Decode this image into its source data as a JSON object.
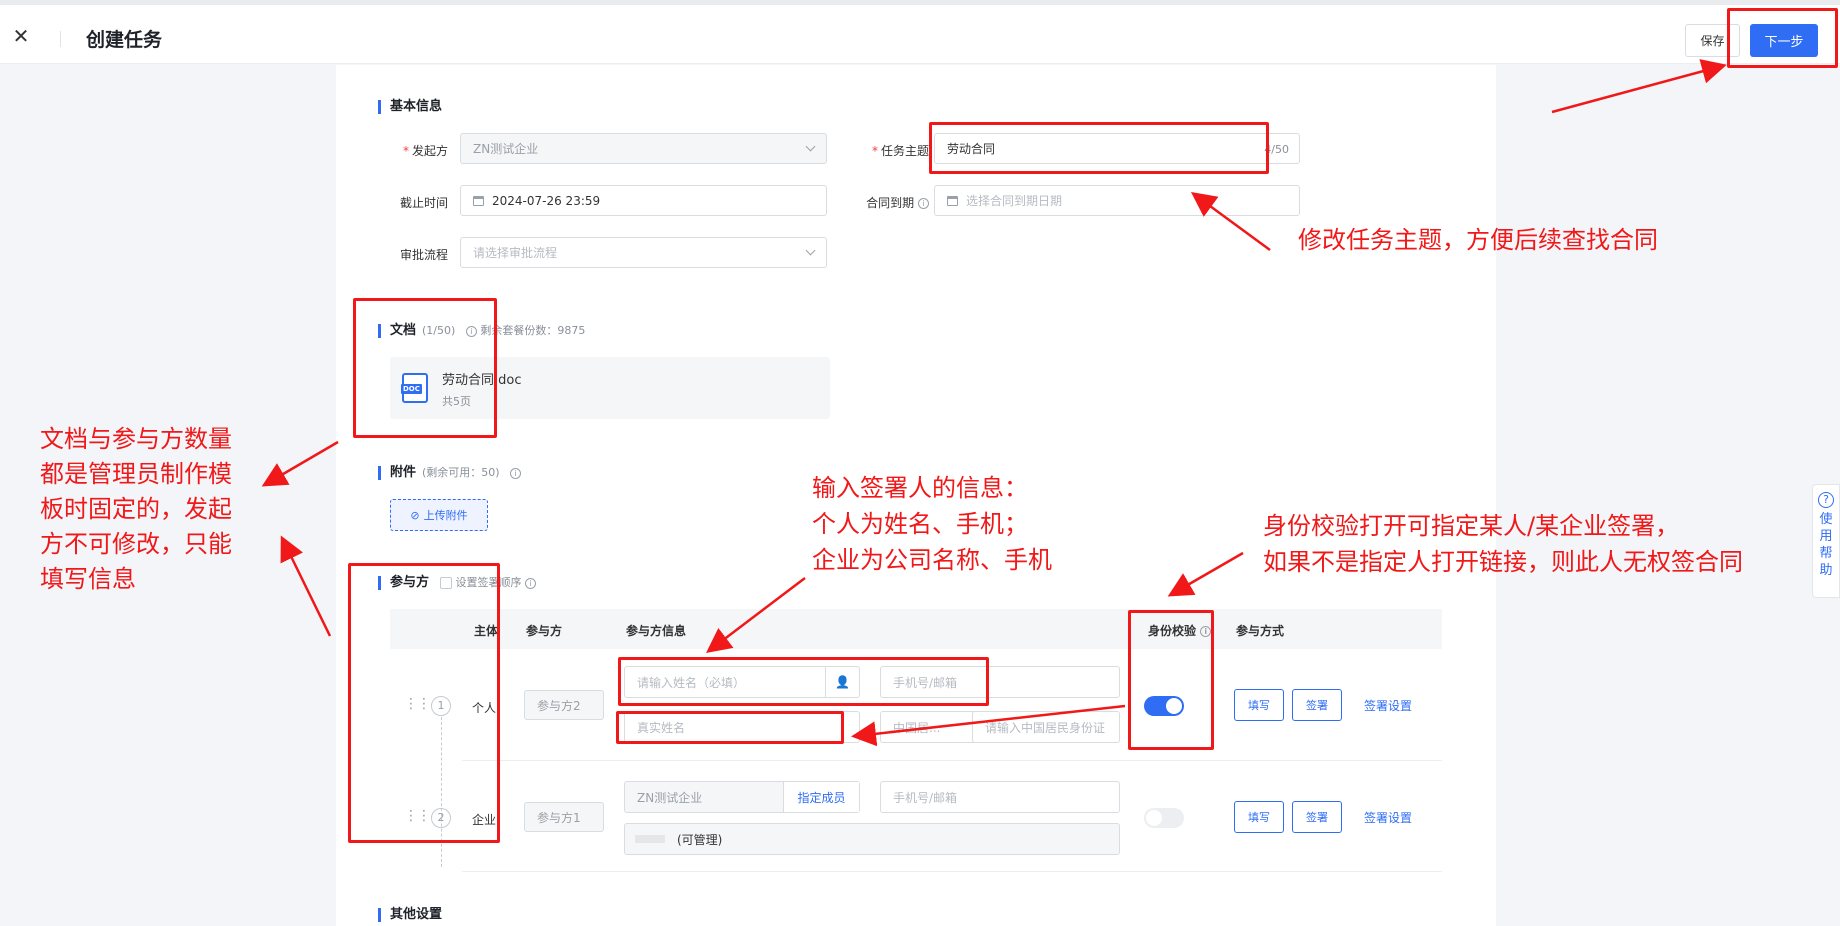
{
  "header": {
    "title": "创建任务",
    "save_label": "保存",
    "next_label": "下一步"
  },
  "basic": {
    "section_title": "基本信息",
    "initiator_label": "发起方",
    "initiator_value": "ZN测试企业",
    "subject_label": "任务主题",
    "subject_value": "劳动合同",
    "subject_counter": "4/50",
    "deadline_label": "截止时间",
    "deadline_value": "2024-07-26 23:59",
    "expiry_label": "合同到期",
    "expiry_placeholder": "选择合同到期日期",
    "approval_label": "审批流程",
    "approval_placeholder": "请选择审批流程"
  },
  "documents": {
    "section_title": "文档",
    "count": "(1/50)",
    "remaining": "剩余套餐份数：9875",
    "file_name": "劳动合同.doc",
    "file_pages": "共5页",
    "file_type_badge": "DOC"
  },
  "attachments": {
    "section_title": "附件",
    "remaining": "(剩余可用：50)",
    "upload_label": "上传附件"
  },
  "participants": {
    "section_title": "参与方",
    "order_label": "设置签署顺序",
    "columns": {
      "subject": "主体",
      "party": "参与方",
      "info": "参与方信息",
      "id_check": "身份校验",
      "method": "参与方式"
    },
    "rows": [
      {
        "index": "1",
        "subject": "个人",
        "party": "参与方2",
        "name_placeholder": "请输入姓名（必填）",
        "contact_placeholder": "手机号/邮箱",
        "real_name_placeholder": "真实姓名",
        "id_type": "中国居...",
        "id_placeholder": "请输入中国居民身份证",
        "id_check_on": true,
        "fill_label": "填写",
        "sign_label": "签署",
        "settings_label": "签署设置"
      },
      {
        "index": "2",
        "subject": "企业",
        "party": "参与方1",
        "company_value": "ZN测试企业",
        "assign_label": "指定成员",
        "contact_placeholder": "手机号/邮箱",
        "member_suffix": "(可管理)",
        "id_check_on": false,
        "fill_label": "填写",
        "sign_label": "签署",
        "settings_label": "签署设置"
      }
    ]
  },
  "other": {
    "section_title": "其他设置"
  },
  "help": {
    "icon": "?",
    "label": "使用帮助"
  },
  "annotations": {
    "subject_note": "修改任务主题，方便后续查找合同",
    "doc_note_lines": [
      "文档与参与方数量",
      "都是管理员制作模",
      "板时固定的，发起",
      "方不可修改，只能",
      "填写信息"
    ],
    "signer_note_lines": [
      "输入签署人的信息：",
      "个人为姓名、手机；",
      "企业为公司名称、手机"
    ],
    "idcheck_note_lines": [
      "身份校验打开可指定某人/某企业签署，",
      "如果不是指定人打开链接，则此人无权签合同"
    ]
  },
  "colors": {
    "primary": "#2f6df5",
    "annotation_red": "#f01818"
  }
}
